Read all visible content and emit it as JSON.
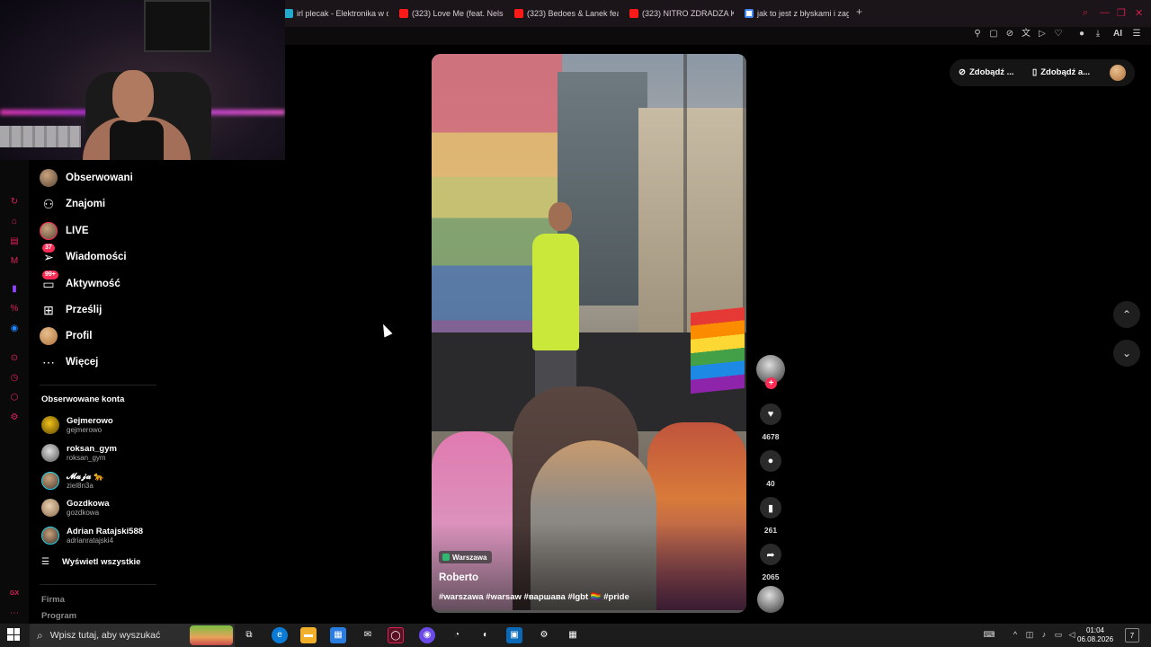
{
  "browser": {
    "tabs": [
      {
        "title": "irl plecak - Elektronika w d",
        "icon": "image-favicon"
      },
      {
        "title": "(323) Love Me (feat. Nelso",
        "icon": "youtube-icon"
      },
      {
        "title": "(323) Bedoes & Lanek feat",
        "icon": "youtube-icon"
      },
      {
        "title": "(323) NITRO ZDRADZA KO",
        "icon": "youtube-icon"
      },
      {
        "title": "jak to jest z błyskami i zagr",
        "icon": "google-icon"
      }
    ],
    "new_tab_symbol": "+",
    "toolbar_ai_label": "AI"
  },
  "sidebar": {
    "nav": [
      {
        "id": "following",
        "label": "Obserwowani",
        "icon": "avatar-icon"
      },
      {
        "id": "friends",
        "label": "Znajomi",
        "icon": "friends-icon"
      },
      {
        "id": "live",
        "label": "LIVE",
        "icon": "live-avatar-icon"
      },
      {
        "id": "messages",
        "label": "Wiadomości",
        "icon": "paper-plane-icon",
        "badge": "37"
      },
      {
        "id": "activity",
        "label": "Aktywność",
        "icon": "chat-icon",
        "badge": "99+"
      },
      {
        "id": "upload",
        "label": "Prześlij",
        "icon": "plus-square-icon"
      },
      {
        "id": "profile",
        "label": "Profil",
        "icon": "profile-avatar-icon"
      },
      {
        "id": "more",
        "label": "Więcej",
        "icon": "more-icon"
      }
    ],
    "followed_accounts_title": "Obserwowane konta",
    "accounts": [
      {
        "name": "Gejmerowo",
        "handle": "gejmerowo"
      },
      {
        "name": "roksan_gym",
        "handle": "roksan_gym"
      },
      {
        "name": "𝓜𝓪𝓳𝓪 🐆",
        "handle": "ziel8n3a"
      },
      {
        "name": "Gozdkowa",
        "handle": "gozdkowa"
      },
      {
        "name": "Adrian Ratajski588",
        "handle": "adrianratajski4"
      }
    ],
    "show_all_label": "Wyświetl wszystkie",
    "footer_links": [
      "Firma",
      "Program"
    ]
  },
  "video": {
    "location": "Warszawa",
    "author": "Roberto",
    "caption": "#warszawa #warsaw #варшава #lgbt 🏳️‍🌈 #pride",
    "progress": 0.0
  },
  "actions": {
    "likes": "4678",
    "comments": "40",
    "saves": "261",
    "shares": "2065"
  },
  "top_actions": {
    "coins_label": "Zdobądź ...",
    "app_label": "Zdobądź a..."
  },
  "taskbar": {
    "search_placeholder": "Wpisz tutaj, aby wyszukać",
    "time": "01:04",
    "date": "06.08.2026",
    "notification_count": "7"
  },
  "colors": {
    "accent": "#fe2c55",
    "opera_red": "#e0205a",
    "background": "#000000"
  }
}
